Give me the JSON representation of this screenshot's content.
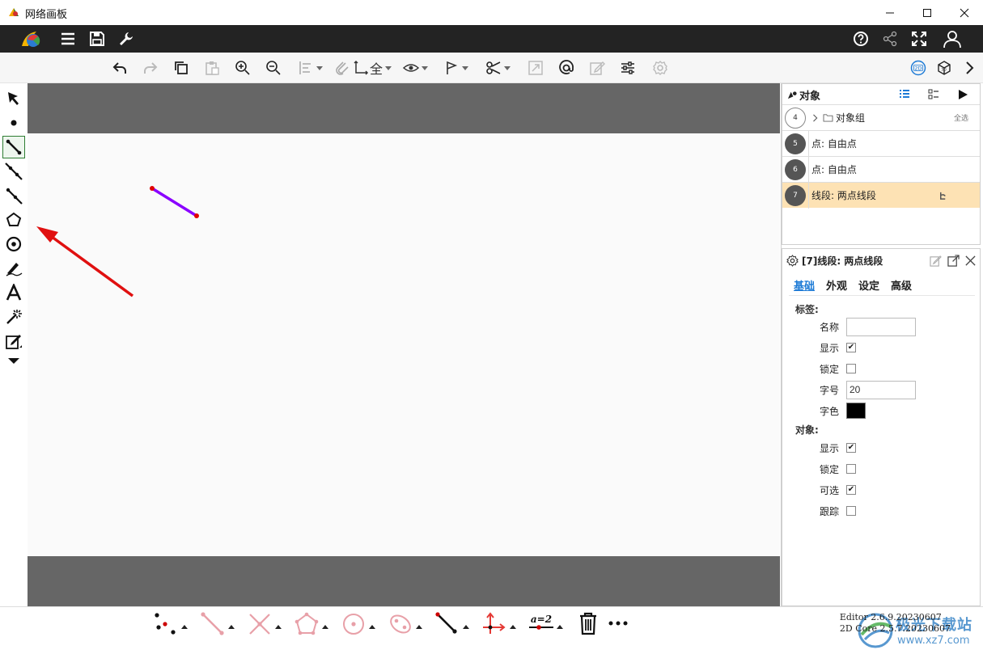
{
  "window": {
    "title": "网络画板",
    "controls": [
      "minimize-icon",
      "maximize-icon",
      "close-icon"
    ]
  },
  "header": {
    "left_icons": [
      "app-logo",
      "menu-icon",
      "save-icon",
      "wrench-icon"
    ],
    "right_icons": [
      "help-icon",
      "share-icon",
      "fullscreen-icon",
      "user-icon"
    ]
  },
  "toolbar": {
    "items": [
      "undo-icon",
      "redo-icon",
      "copy-icon",
      "paste-icon",
      "zoom-in-icon",
      "zoom-out-icon",
      "align-icon",
      "snap-icon",
      "axis-icon",
      "eye-icon",
      "flag-icon",
      "transform-icon",
      "expand-icon",
      "at-icon",
      "edit-icon",
      "sliders-icon",
      "gear-icon"
    ],
    "axis_label": "全",
    "mode_2d": "2D",
    "mode_3d": "3D"
  },
  "left_tools": [
    "pointer-tool",
    "point-tool",
    "segment-tool",
    "line-tool",
    "ray-tool",
    "polygon-tool",
    "circle-tool",
    "pen-tool",
    "text-tool",
    "magic-tool",
    "edit-tool",
    "more-tools"
  ],
  "objects_panel": {
    "title": "对象",
    "rows": [
      {
        "num": "4",
        "label": "对象组",
        "extra": "全选",
        "hollow": true
      },
      {
        "num": "5",
        "label": "点: 自由点"
      },
      {
        "num": "6",
        "label": "点: 自由点"
      },
      {
        "num": "7",
        "label": "线段: 两点线段",
        "selected": true
      }
    ]
  },
  "props_panel": {
    "title": "[7]线段: 两点线段",
    "tabs": [
      "基础",
      "外观",
      "设定",
      "高级"
    ],
    "label_section": "标签:",
    "name_label": "名称",
    "name_value": "",
    "show_label": "显示",
    "lock_label": "锁定",
    "font_size_label": "字号",
    "font_size_value": "20",
    "font_color_label": "字色",
    "font_color": "#000000",
    "object_section": "对象:",
    "obj_show_label": "显示",
    "obj_lock_label": "锁定",
    "obj_select_label": "可选",
    "obj_trace_label": "跟踪",
    "label_show": true,
    "label_lock": false,
    "obj_show": true,
    "obj_lock": false,
    "obj_select": true,
    "obj_trace": false
  },
  "bottom_tools": [
    "points-tool",
    "segment-tool",
    "intersect-tool",
    "polygon-tool",
    "circle-tool",
    "ellipse-tool",
    "vector-tool",
    "axes-tool",
    "variable-tool",
    "trash-icon",
    "more-icon"
  ],
  "bottom_variable_label": "a=2",
  "version": {
    "editor": "Editor 2.6.9.20230607",
    "core": "2D Core 2.5.7.20230607"
  },
  "watermark": {
    "text": "极光下载站",
    "url": "www.xz7.com"
  },
  "colors": {
    "segment": "#8a00ff",
    "point": "#e00000",
    "accent": "#1e7bd6",
    "selected_row": "#fde2b4",
    "annotation_arrow": "#e01010"
  }
}
